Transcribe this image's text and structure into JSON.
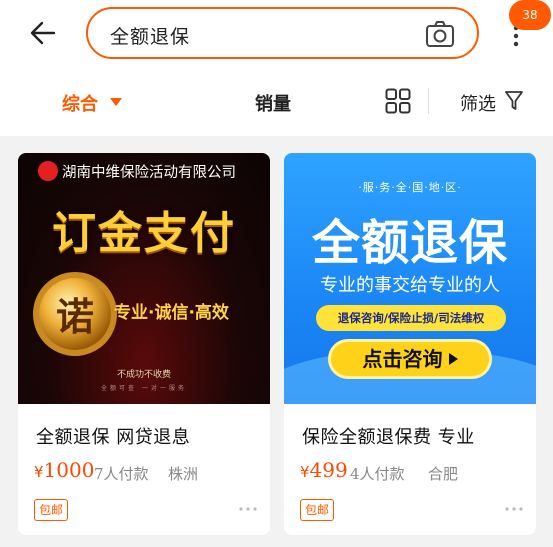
{
  "header": {
    "back_icon": "back-arrow-icon",
    "search_query": "全额退保",
    "camera_icon": "camera-icon",
    "more_icon": "more-vertical-icon",
    "notification_count": "38"
  },
  "filters": {
    "sort_label": "综合",
    "sales_label": "销量",
    "layout_icon": "grid-layout-icon",
    "filter_label": "筛选",
    "filter_icon": "funnel-icon",
    "active_color": "#ff5a00"
  },
  "products": [
    {
      "title": "全额退保  网贷退息",
      "currency": "¥",
      "price": "1000",
      "buyers": "7人付款",
      "location": "株洲",
      "tag": "包邮",
      "image": {
        "company": "湖南中维保险活动有限公司",
        "headline": "订金支付",
        "seal_char": "诺",
        "slogan": "专业·诚信·高效",
        "note": "不成功不收费",
        "fine_print": "全额可查 一对一服务"
      }
    },
    {
      "title": "保险全额退保费 专业",
      "currency": "¥",
      "price": "499",
      "buyers": "4人付款",
      "location": "合肥",
      "tag": "包邮",
      "image": {
        "service": "·服·务·全·国·地·区·",
        "headline": "全额退保",
        "subline": "专业的事交给专业的人",
        "pill": "退保咨询/保险止损/司法维权",
        "button": "点击咨询"
      }
    }
  ]
}
